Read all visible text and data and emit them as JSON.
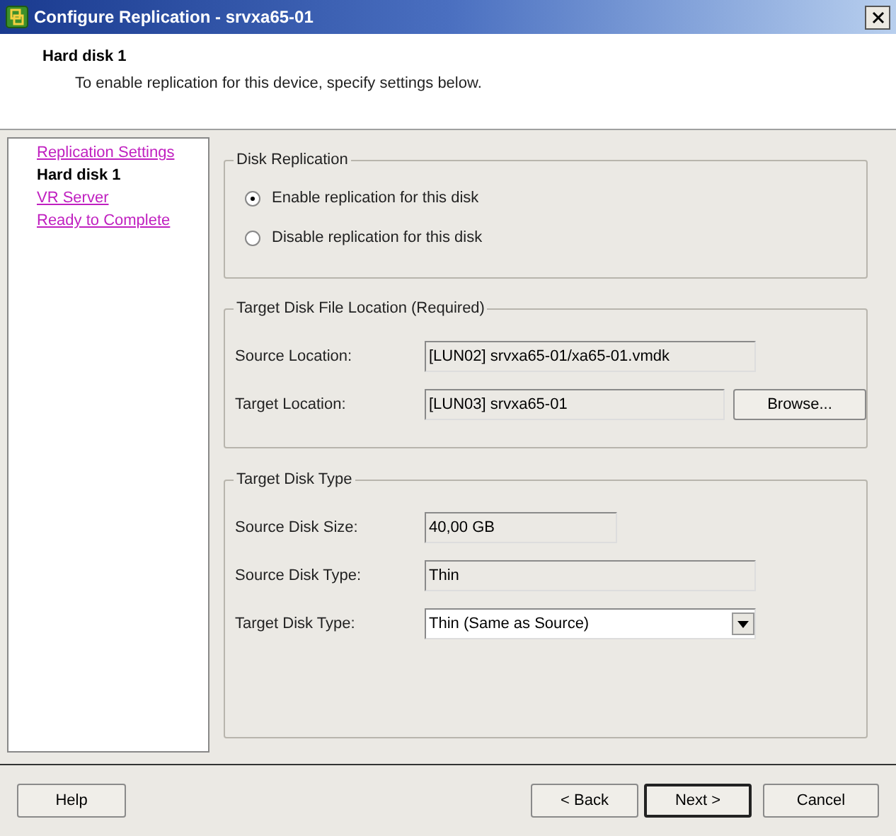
{
  "window": {
    "title": "Configure Replication - srvxa65-01"
  },
  "header": {
    "title": "Hard disk 1",
    "subtitle": "To enable replication for this device, specify settings below."
  },
  "steps": [
    {
      "label": "Replication Settings",
      "selected": false
    },
    {
      "label": "Hard disk 1",
      "selected": true
    },
    {
      "label": "VR Server",
      "selected": false
    },
    {
      "label": "Ready to Complete",
      "selected": false
    }
  ],
  "disk_replication": {
    "title": "Disk Replication",
    "options": [
      {
        "label": "Enable replication for this disk",
        "selected": true
      },
      {
        "label": "Disable replication for this disk",
        "selected": false
      }
    ]
  },
  "target_location": {
    "title": "Target Disk File Location (Required)",
    "fields": [
      {
        "label": "Source Location:",
        "value": "[LUN02] srvxa65-01/xa65-01.vmdk",
        "kind": "readonly"
      },
      {
        "label": "Target Location:",
        "value": "[LUN03] srvxa65-01",
        "kind": "browse",
        "button": "Browse..."
      }
    ]
  },
  "target_type": {
    "title": "Target Disk Type",
    "fields": [
      {
        "label": "Source Disk Size:",
        "value": "40,00 GB",
        "kind": "short"
      },
      {
        "label": "Source Disk Type:",
        "value": "Thin",
        "kind": "readonly"
      },
      {
        "label": "Target Disk Type:",
        "value": "Thin (Same as Source)",
        "kind": "dropdown"
      }
    ]
  },
  "buttons": {
    "help": "Help",
    "back": "< Back",
    "next": "Next >",
    "cancel": "Cancel"
  }
}
